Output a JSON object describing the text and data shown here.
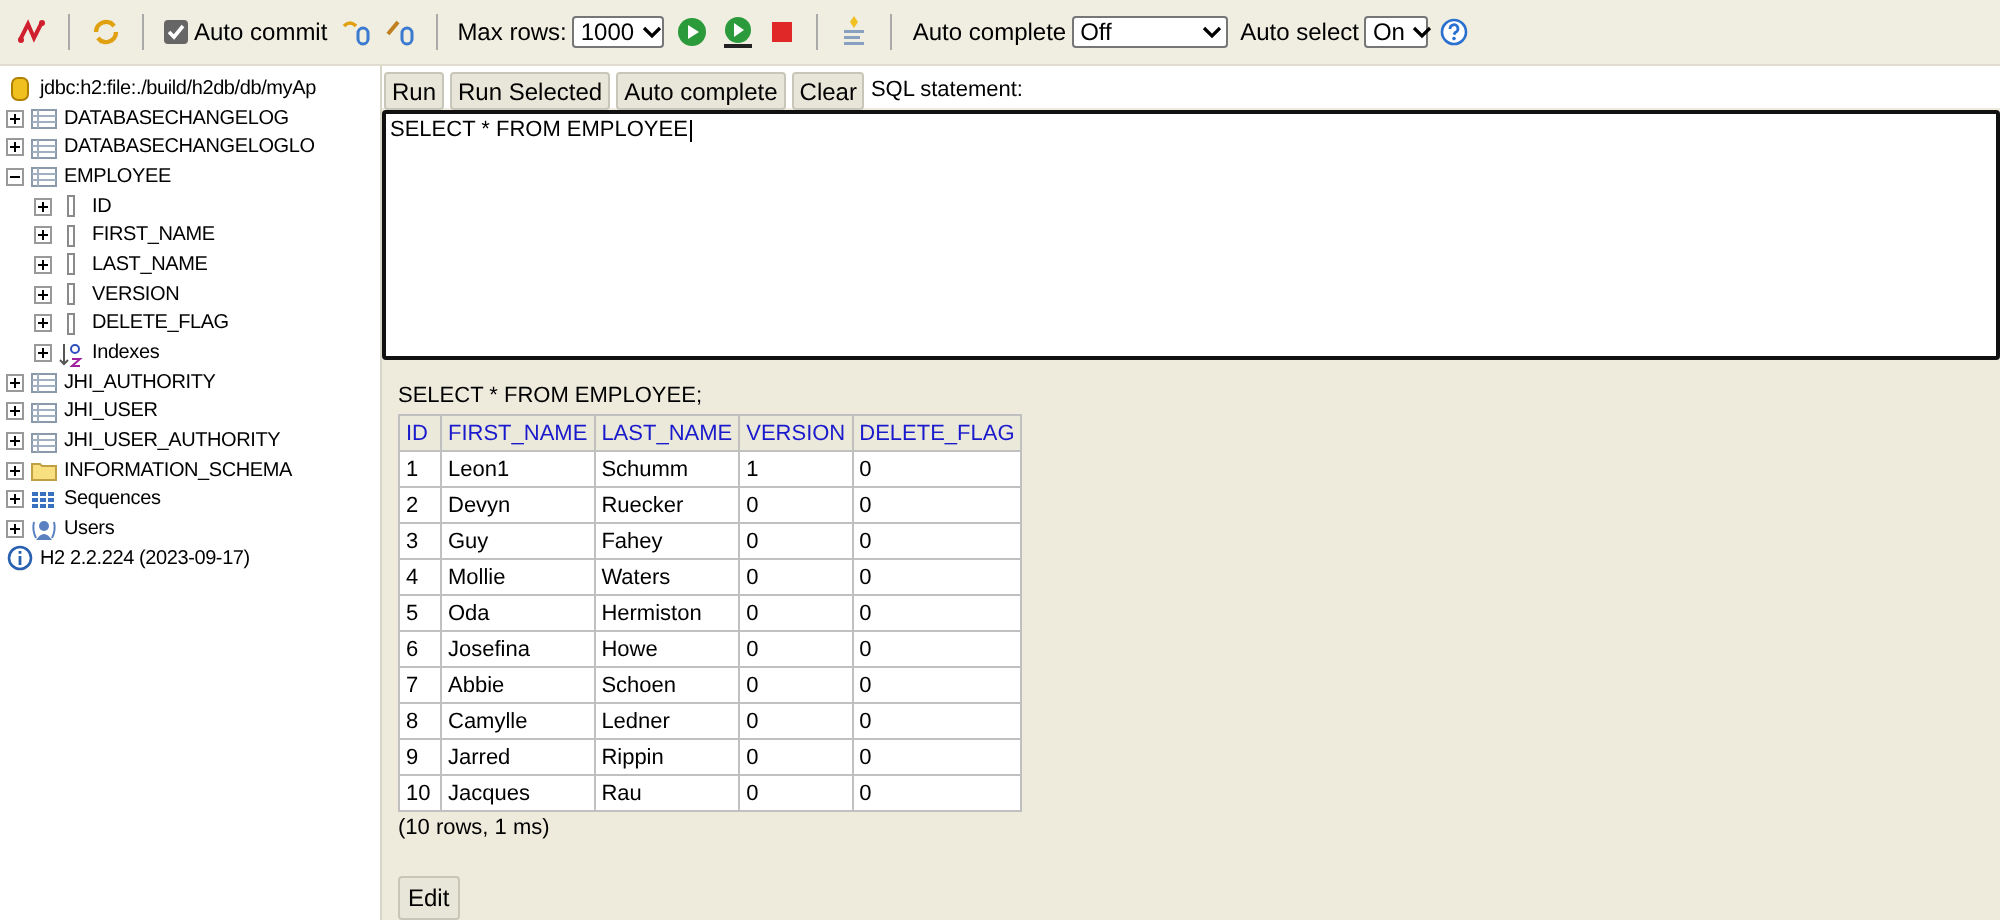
{
  "toolbar": {
    "auto_commit": {
      "label": "Auto commit",
      "checked": true
    },
    "max_rows": {
      "label": "Max rows:",
      "value": "1000"
    },
    "auto_complete": {
      "label": "Auto complete",
      "value": "Off"
    },
    "auto_select": {
      "label": "Auto select",
      "value": "On"
    }
  },
  "tree": [
    {
      "kind": "connection",
      "label": "jdbc:h2:file:./build/h2db/db/myAp"
    },
    {
      "kind": "table",
      "label": "DATABASECHANGELOG",
      "expanded": false
    },
    {
      "kind": "table",
      "label": "DATABASECHANGELOGLO",
      "expanded": false
    },
    {
      "kind": "table",
      "label": "EMPLOYEE",
      "expanded": true,
      "children": [
        {
          "kind": "column",
          "label": "ID",
          "expanded": false
        },
        {
          "kind": "column",
          "label": "FIRST_NAME",
          "expanded": false
        },
        {
          "kind": "column",
          "label": "LAST_NAME",
          "expanded": false
        },
        {
          "kind": "column",
          "label": "VERSION",
          "expanded": false
        },
        {
          "kind": "column",
          "label": "DELETE_FLAG",
          "expanded": false
        },
        {
          "kind": "index",
          "label": "Indexes",
          "expanded": false
        }
      ]
    },
    {
      "kind": "table",
      "label": "JHI_AUTHORITY",
      "expanded": false
    },
    {
      "kind": "table",
      "label": "JHI_USER",
      "expanded": false
    },
    {
      "kind": "table",
      "label": "JHI_USER_AUTHORITY",
      "expanded": false
    },
    {
      "kind": "folder",
      "label": "INFORMATION_SCHEMA",
      "expanded": false
    },
    {
      "kind": "sequences",
      "label": "Sequences",
      "expanded": false
    },
    {
      "kind": "users",
      "label": "Users",
      "expanded": false
    },
    {
      "kind": "info",
      "label": "H2 2.2.224 (2023-09-17)"
    }
  ],
  "query": {
    "buttons": [
      "Run",
      "Run Selected",
      "Auto complete",
      "Clear"
    ],
    "label": "SQL statement:",
    "sql": "SELECT * FROM EMPLOYEE"
  },
  "result": {
    "statement": "SELECT * FROM EMPLOYEE;",
    "columns": [
      "ID",
      "FIRST_NAME",
      "LAST_NAME",
      "VERSION",
      "DELETE_FLAG"
    ],
    "rows": [
      [
        "1",
        "Leon1",
        "Schumm",
        "1",
        "0"
      ],
      [
        "2",
        "Devyn",
        "Ruecker",
        "0",
        "0"
      ],
      [
        "3",
        "Guy",
        "Fahey",
        "0",
        "0"
      ],
      [
        "4",
        "Mollie",
        "Waters",
        "0",
        "0"
      ],
      [
        "5",
        "Oda",
        "Hermiston",
        "0",
        "0"
      ],
      [
        "6",
        "Josefina",
        "Howe",
        "0",
        "0"
      ],
      [
        "7",
        "Abbie",
        "Schoen",
        "0",
        "0"
      ],
      [
        "8",
        "Camylle",
        "Ledner",
        "0",
        "0"
      ],
      [
        "9",
        "Jarred",
        "Rippin",
        "0",
        "0"
      ],
      [
        "10",
        "Jacques",
        "Rau",
        "0",
        "0"
      ]
    ],
    "summary": "(10 rows, 1 ms)",
    "edit_button": "Edit"
  }
}
